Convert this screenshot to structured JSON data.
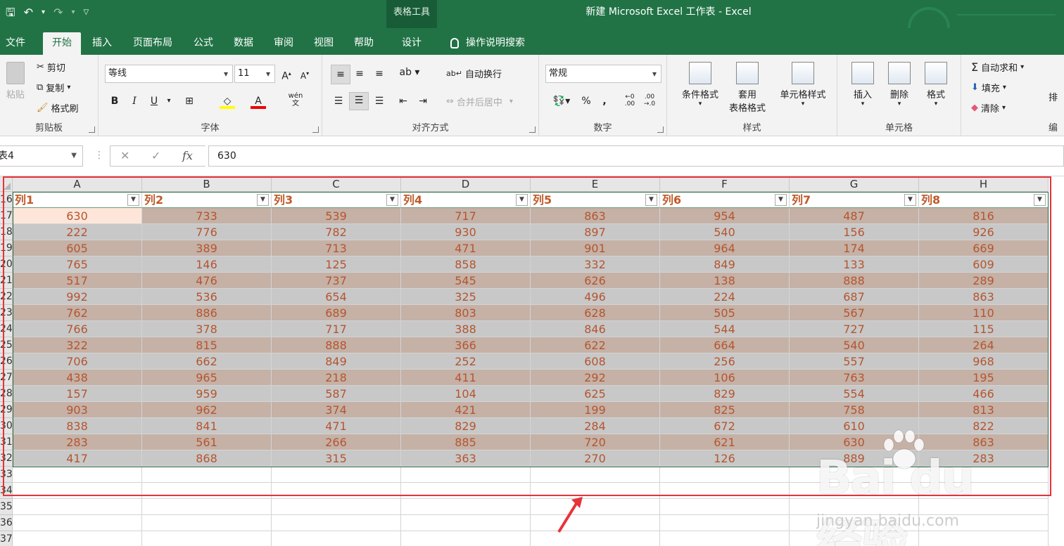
{
  "title_bar": {
    "window_title": "新建 Microsoft Excel 工作表  -  Excel",
    "context_group": "表格工具"
  },
  "tabs": [
    {
      "label": "文件"
    },
    {
      "label": "开始"
    },
    {
      "label": "插入"
    },
    {
      "label": "页面布局"
    },
    {
      "label": "公式"
    },
    {
      "label": "数据"
    },
    {
      "label": "审阅"
    },
    {
      "label": "视图"
    },
    {
      "label": "帮助"
    },
    {
      "label": "设计"
    }
  ],
  "tell_me": "操作说明搜索",
  "ribbon": {
    "clipboard": {
      "label": "剪贴板",
      "paste": "粘贴",
      "cut": "剪切",
      "copy": "复制",
      "format_painter": "格式刷"
    },
    "font": {
      "label": "字体",
      "font_name": "等线",
      "font_size": "11",
      "bold": "B",
      "italic": "I",
      "underline": "U",
      "phonetic": "wén文"
    },
    "alignment": {
      "label": "对齐方式",
      "wrap_text": "自动换行",
      "merge_center": "合并后居中"
    },
    "number": {
      "label": "数字",
      "format": "常规",
      "percent": "%",
      "comma": ","
    },
    "styles": {
      "label": "样式",
      "conditional": "条件格式",
      "format_table_1": "套用",
      "format_table_2": "表格格式",
      "cell_styles": "单元格样式"
    },
    "cells": {
      "label": "单元格",
      "insert": "插入",
      "delete": "删除",
      "format": "格式"
    },
    "editing": {
      "label": "编",
      "autosum": "自动求和",
      "fill": "填充",
      "clear": "清除",
      "sort": "排"
    }
  },
  "formula_bar": {
    "name_box": "表4",
    "fx": "fx",
    "value": "630"
  },
  "grid": {
    "columns": [
      "A",
      "B",
      "C",
      "D",
      "E",
      "F",
      "G",
      "H"
    ],
    "header_row_number": "16",
    "table_headers": [
      "列1",
      "列2",
      "列3",
      "列4",
      "列5",
      "列6",
      "列7",
      "列8"
    ],
    "row_numbers": [
      "17",
      "18",
      "19",
      "20",
      "21",
      "22",
      "23",
      "24",
      "25",
      "26",
      "27",
      "28",
      "29",
      "30",
      "31",
      "32"
    ],
    "rows": [
      [
        "630",
        "733",
        "539",
        "717",
        "863",
        "954",
        "487",
        "816"
      ],
      [
        "222",
        "776",
        "782",
        "930",
        "897",
        "540",
        "156",
        "926"
      ],
      [
        "605",
        "389",
        "713",
        "471",
        "901",
        "964",
        "174",
        "669"
      ],
      [
        "765",
        "146",
        "125",
        "858",
        "332",
        "849",
        "133",
        "609"
      ],
      [
        "517",
        "476",
        "737",
        "545",
        "626",
        "138",
        "888",
        "289"
      ],
      [
        "992",
        "536",
        "654",
        "325",
        "496",
        "224",
        "687",
        "863"
      ],
      [
        "762",
        "886",
        "689",
        "803",
        "628",
        "505",
        "567",
        "110"
      ],
      [
        "766",
        "378",
        "717",
        "388",
        "846",
        "544",
        "727",
        "115"
      ],
      [
        "322",
        "815",
        "888",
        "366",
        "622",
        "664",
        "540",
        "264"
      ],
      [
        "706",
        "662",
        "849",
        "252",
        "608",
        "256",
        "557",
        "968"
      ],
      [
        "438",
        "965",
        "218",
        "411",
        "292",
        "106",
        "763",
        "195"
      ],
      [
        "157",
        "959",
        "587",
        "104",
        "625",
        "829",
        "554",
        "466"
      ],
      [
        "903",
        "962",
        "374",
        "421",
        "199",
        "825",
        "758",
        "813"
      ],
      [
        "838",
        "841",
        "471",
        "829",
        "284",
        "672",
        "610",
        "822"
      ],
      [
        "283",
        "561",
        "266",
        "885",
        "720",
        "621",
        "630",
        "863"
      ],
      [
        "417",
        "868",
        "315",
        "363",
        "270",
        "126",
        "889",
        "283"
      ]
    ],
    "empty_row_numbers": [
      "33",
      "34",
      "35",
      "36",
      "37"
    ]
  },
  "watermark": {
    "logo": "Bai du 经验",
    "url": "jingyan.baidu.com"
  },
  "colors": {
    "excel_green": "#217346",
    "band_tan": "#c5b1a6",
    "band_gray": "#c8c8c8",
    "text_orange": "#b5552f",
    "highlight_red": "#e8323a"
  }
}
